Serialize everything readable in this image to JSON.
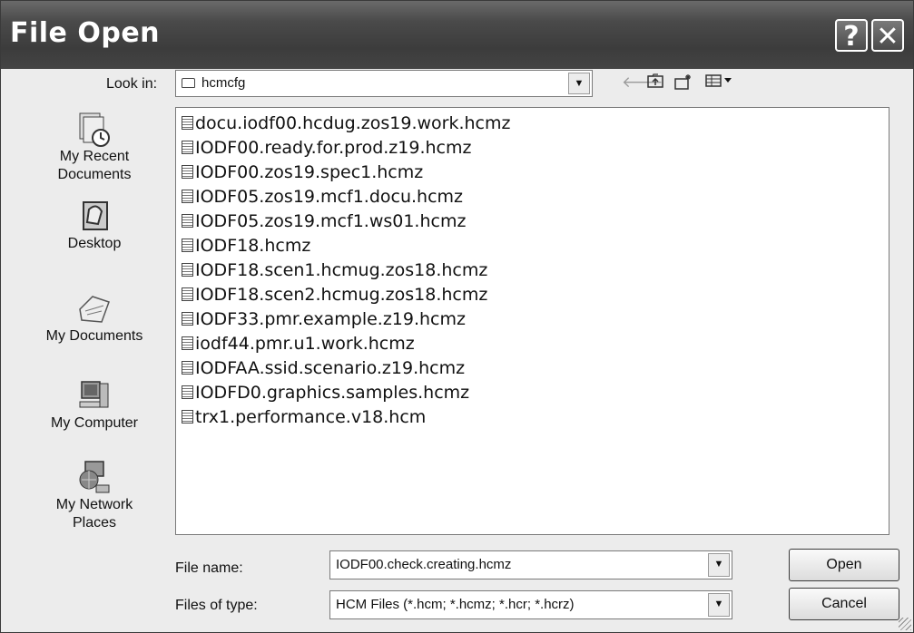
{
  "window": {
    "title": "File Open",
    "help_label": "?",
    "close_label": "✕"
  },
  "lookin": {
    "label": "Look in:",
    "value": "hcmcfg",
    "icons": [
      "back-arrow-icon",
      "up-folder-icon",
      "new-folder-icon",
      "view-menu-icon"
    ]
  },
  "places": [
    {
      "label": "My Recent Documents",
      "line1": "My Recent",
      "line2": "Documents",
      "icon": "recent-documents-icon"
    },
    {
      "label": "Desktop",
      "line1": "Desktop",
      "line2": "",
      "icon": "desktop-icon"
    },
    {
      "label": "My Documents",
      "line1": "My Documents",
      "line2": "",
      "icon": "my-documents-icon"
    },
    {
      "label": "My Computer",
      "line1": "My Computer",
      "line2": "",
      "icon": "my-computer-icon"
    },
    {
      "label": "My Network Places",
      "line1": "My Network",
      "line2": "Places",
      "icon": "network-places-icon"
    }
  ],
  "files": [
    "docu.iodf00.hcdug.zos19.work.hcmz",
    "IODF00.ready.for.prod.z19.hcmz",
    "IODF00.zos19.spec1.hcmz",
    "IODF05.zos19.mcf1.docu.hcmz",
    "IODF05.zos19.mcf1.ws01.hcmz",
    "IODF18.hcmz",
    "IODF18.scen1.hcmug.zos18.hcmz",
    "IODF18.scen2.hcmug.zos18.hcmz",
    "IODF33.pmr.example.z19.hcmz",
    "iodf44.pmr.u1.work.hcmz",
    "IODFAA.ssid.scenario.z19.hcmz",
    "IODFD0.graphics.samples.hcmz",
    "trx1.performance.v18.hcm"
  ],
  "filename": {
    "label": "File name:",
    "value": "IODF00.check.creating.hcmz"
  },
  "filetype": {
    "label": "Files of type:",
    "value": "HCM Files (*.hcm; *.hcmz; *.hcr; *.hcrz)"
  },
  "buttons": {
    "open": "Open",
    "cancel": "Cancel"
  }
}
